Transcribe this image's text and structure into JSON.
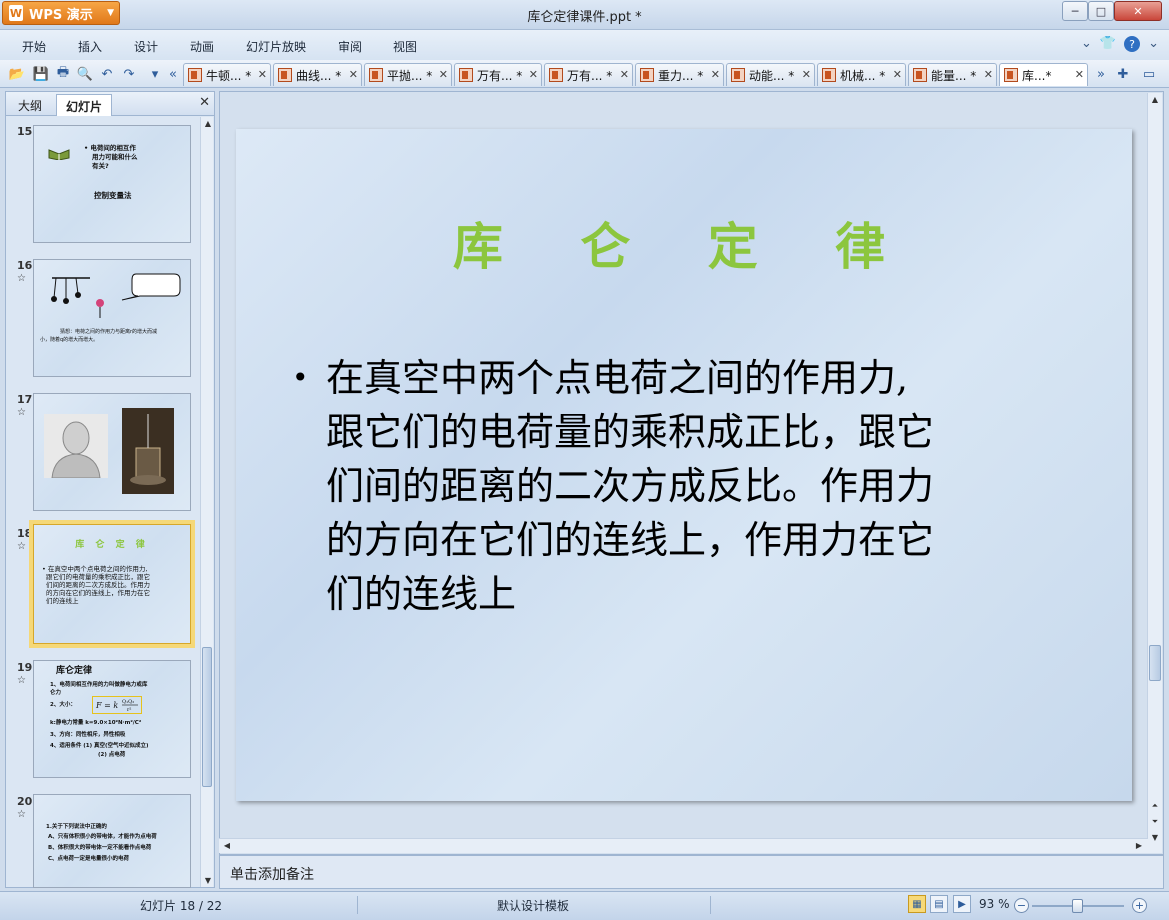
{
  "app": {
    "name": "WPS 演示",
    "window_title": "库仑定律课件.ppt *"
  },
  "menu": [
    "开始",
    "插入",
    "设计",
    "动画",
    "幻灯片放映",
    "审阅",
    "视图"
  ],
  "doc_tabs": [
    "牛顿... *",
    "曲线... *",
    "平抛... *",
    "万有... *",
    "万有... *",
    "重力... *",
    "动能... *",
    "机械... *",
    "能量... *",
    "库...*"
  ],
  "pane": {
    "tabs": [
      "大纲",
      "幻灯片"
    ],
    "active_tab": "幻灯片"
  },
  "thumbnails": [
    {
      "num": "15",
      "lines": [
        "• 电荷间的相互作",
        "用力可能和什么",
        "有关?",
        "控制变量法"
      ]
    },
    {
      "num": "16",
      "star": "☆",
      "lines": [
        "猜想：电荷之间的作用力与距离r的增大而减",
        "小，随着q的增大而增大。"
      ]
    },
    {
      "num": "17",
      "star": "☆"
    },
    {
      "num": "18",
      "star": "☆",
      "title": "库 仑 定 律",
      "lines": [
        "• 在真空中两个点电荷之间的作用力,",
        "跟它们的电荷量的乘积成正比，跟它",
        "们间的距离的二次方成反比。作用力",
        "的方向在它们的连线上，作用力在它",
        "们的连线上"
      ]
    },
    {
      "num": "19",
      "star": "☆",
      "title": "库仑定律",
      "lines": [
        "1、电荷间相互作用的力叫做静电力或库",
        "仑力",
        "2、大小：",
        "k:静电力常量  k=9.0×10⁹N·m²/C²",
        "3、方向：同性相斥，异性相吸",
        "4、适用条件  (1) 真空(空气中近似成立)",
        "(2) 点电荷"
      ]
    },
    {
      "num": "20",
      "star": "☆",
      "lines": [
        "1.关于下列说法中正确的",
        "A、只有体积很小的带电体，才能作为点电荷",
        "B、体积很大的带电体一定不能看作点电荷",
        "C、点电荷一定是电量很小的电荷"
      ]
    }
  ],
  "slide": {
    "title": "库 仑 定 律",
    "bullet": "•",
    "body_lines": [
      "在真空中两个点电荷之间的作用力,",
      "跟它们的电荷量的乘积成正比，跟它",
      "们间的距离的二次方成反比。作用力",
      "的方向在它们的连线上，作用力在它",
      "们的连线上"
    ]
  },
  "notes_placeholder": "单击添加备注",
  "status": {
    "slide_counter": "幻灯片 18 / 22",
    "template": "默认设计模板",
    "zoom": "93 %"
  },
  "colors": {
    "title_green": "#8cc63e",
    "accent_orange": "#e0781a",
    "selection_yellow": "#f5d878"
  }
}
